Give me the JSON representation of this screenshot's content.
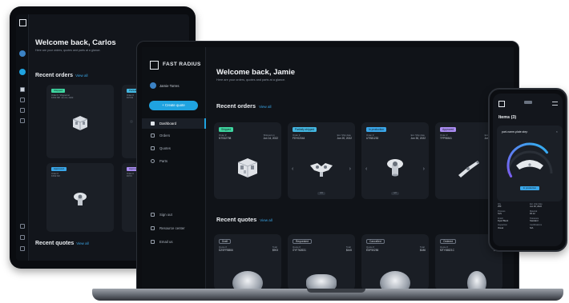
{
  "colors": {
    "accent": "#1fa3e0",
    "link": "#3aa6e8",
    "bg": "#101318",
    "card": "#1a1e25",
    "shipped": "#3ed6a0",
    "partial": "#43b6e0",
    "production": "#3aa6e8",
    "approved": "#a98bf0",
    "placed": "#a98bf0"
  },
  "tablet": {
    "title": "Welcome back, Carlos",
    "subtitle": "Here are your orders, quotes and parts at a glance.",
    "recent_orders": "Recent orders",
    "view_all": "View all",
    "recent_quotes": "Recent quotes",
    "cards": [
      {
        "badge": "Shipped",
        "id_label": "Order #",
        "id": "KFS1798",
        "date_label": "Shipped at",
        "date": "Jun 14, 2022"
      },
      {
        "badge": "Partially shipped",
        "id_label": "Order #",
        "id": "FDY02",
        "date_label": "",
        "date": ""
      },
      {
        "badge": "Approved",
        "id_label": "Order #",
        "id": "KFS1720",
        "date_label": "Shipped at",
        "date": "Jun 14, 2022"
      },
      {
        "badge": "Approved",
        "id_label": "Order #",
        "id": "FDY0",
        "date_label": "",
        "date": ""
      }
    ]
  },
  "laptop": {
    "brand": "FAST RADIUS",
    "user": "Jamie Torres",
    "create_quote": "+ Create quote",
    "nav": [
      {
        "label": "Dashboard",
        "icon": "dashboard-icon"
      },
      {
        "label": "Orders",
        "icon": "orders-icon"
      },
      {
        "label": "Quotes",
        "icon": "quotes-icon"
      },
      {
        "label": "Parts",
        "icon": "parts-icon"
      }
    ],
    "nav_bottom": [
      {
        "label": "Sign out",
        "icon": "sign-out-icon"
      },
      {
        "label": "Resource center",
        "icon": "resource-icon"
      },
      {
        "label": "Email us",
        "icon": "mail-icon"
      }
    ],
    "title": "Welcome back, Jamie",
    "subtitle": "Here are your orders, quotes and parts at a glance.",
    "recent_orders": "Recent orders",
    "recent_quotes": "Recent quotes",
    "view_all": "View all",
    "orders": [
      {
        "badge": "Shipped",
        "id_label": "Order #",
        "id": "NTS32798",
        "date_label": "Shipped on",
        "date": "Jun 14, 2022",
        "page": ""
      },
      {
        "badge": "Partially shipped",
        "id_label": "Order #",
        "id": "FDY02044",
        "date_label": "Est. Ship date",
        "date": "Jun 20, 2022",
        "page": "3/4"
      },
      {
        "badge": "In production",
        "id_label": "Order #",
        "id": "UTS81230",
        "date_label": "Est. Ship date",
        "date": "Jun 30, 2022",
        "page": "1/2"
      },
      {
        "badge": "Approved",
        "id_label": "Order #",
        "id": "TFP96541",
        "date_label": "Est. Ship date",
        "date": "Jun 30, 2022",
        "page": ""
      }
    ],
    "quotes": [
      {
        "badge": "Draft",
        "id_label": "Quote #",
        "id": "DZSFR5866",
        "total_label": "Total",
        "total": "$903"
      },
      {
        "badge": "Requested",
        "id_label": "Quote #",
        "id": "XYF762631",
        "total_label": "Total",
        "total": "$445"
      },
      {
        "badge": "Cancelled",
        "id_label": "Quote #",
        "id": "EDF50256",
        "total_label": "Total",
        "total": "$186"
      },
      {
        "badge": "Ordered",
        "id_label": "Quote #",
        "id": "MTY45821C",
        "total_label": "Total",
        "total": "$517"
      }
    ]
  },
  "phone": {
    "items": "Items (3)",
    "file": "part-name-plate.step",
    "status": "In production",
    "progress_fraction": 0.72,
    "meta": [
      {
        "label": "Qty",
        "value": "250"
      },
      {
        "label": "Est. ship date",
        "value": "Jun 30, 2022"
      },
      {
        "label": "Process",
        "value": "SLS"
      },
      {
        "label": "Material",
        "value": "PA 12"
      },
      {
        "label": "Finish",
        "value": "Dyed Black"
      },
      {
        "label": "Tolerance",
        "value": "Standard"
      },
      {
        "label": "Inspection",
        "value": "Visual"
      },
      {
        "label": "Certifications",
        "value": "N/A"
      }
    ]
  }
}
